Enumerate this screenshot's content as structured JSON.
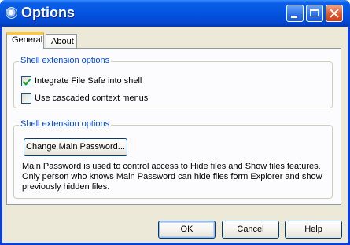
{
  "window": {
    "title": "Options"
  },
  "tabs": [
    {
      "label": "General",
      "active": true
    },
    {
      "label": "About",
      "active": false
    }
  ],
  "group1": {
    "title": "Shell extension options",
    "options": [
      {
        "label": "Integrate File Safe into shell",
        "checked": true
      },
      {
        "label": "Use cascaded context menus",
        "checked": false
      }
    ]
  },
  "group2": {
    "title": "Shell extension options",
    "change_password_label": "Change Main Password...",
    "description": "Main Password is used to control access to Hide files and Show files features. Only person who knows Main Password can hide files form Explorer and show previously hidden files."
  },
  "buttons": {
    "ok": "OK",
    "cancel": "Cancel",
    "help": "Help"
  },
  "colors": {
    "title_bar": "#0454e0",
    "group_title": "#0046d5",
    "tab_highlight": "#ffc83c"
  }
}
